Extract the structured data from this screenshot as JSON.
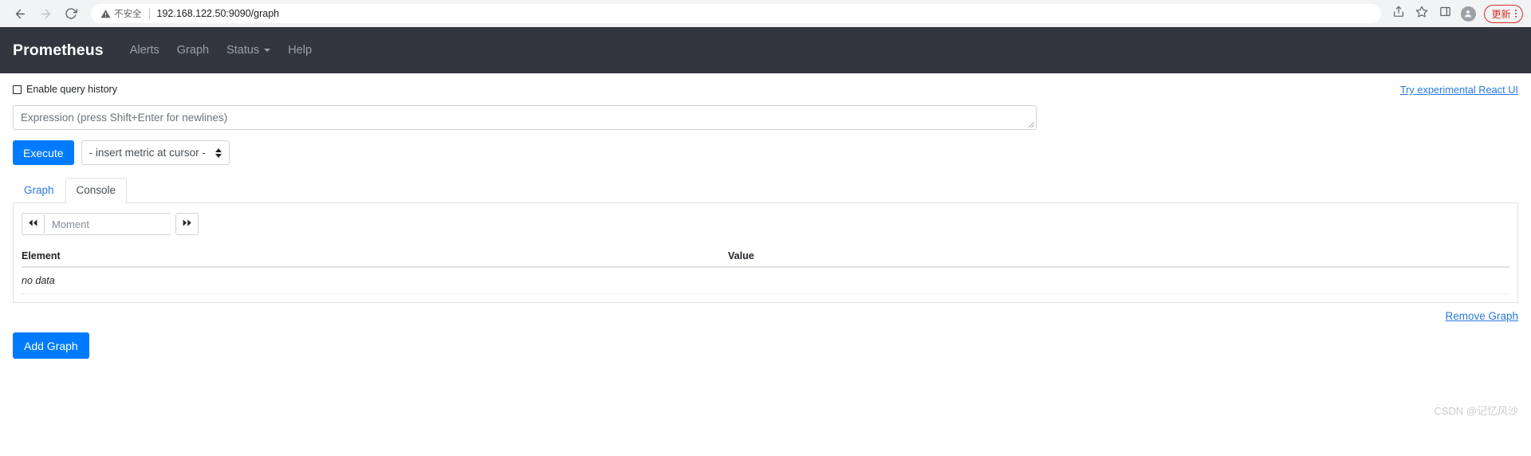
{
  "browser": {
    "back_icon": "arrow-left-icon",
    "forward_icon": "arrow-right-icon",
    "reload_icon": "reload-icon",
    "security_label": "不安全",
    "url": "192.168.122.50:9090/graph",
    "share_icon": "share-icon",
    "bookmark_icon": "star-icon",
    "sidepanel_icon": "side-panel-icon",
    "profile_icon": "profile-avatar-icon",
    "update_label": "更新",
    "menu_icon": "kebab-menu-icon"
  },
  "navbar": {
    "brand": "Prometheus",
    "links": [
      {
        "label": "Alerts",
        "has_caret": false
      },
      {
        "label": "Graph",
        "has_caret": false
      },
      {
        "label": "Status",
        "has_caret": true
      },
      {
        "label": "Help",
        "has_caret": false
      }
    ]
  },
  "query": {
    "history_label": "Enable query history",
    "history_checked": false,
    "react_ui_link": "Try experimental React UI",
    "expression_placeholder": "Expression (press Shift+Enter for newlines)",
    "expression_value": "",
    "execute_label": "Execute",
    "metric_select_value": "- insert metric at cursor -"
  },
  "tabs": [
    {
      "label": "Graph",
      "active": false
    },
    {
      "label": "Console",
      "active": true
    }
  ],
  "console": {
    "prev_icon": "double-chevron-left-icon",
    "next_icon": "double-chevron-right-icon",
    "moment_placeholder": "Moment",
    "moment_value": "",
    "columns": {
      "element": "Element",
      "value": "Value"
    },
    "rows": [],
    "empty_text": "no data"
  },
  "actions": {
    "remove_graph": "Remove Graph",
    "add_graph": "Add Graph"
  },
  "watermark": "CSDN @记忆风沙",
  "colors": {
    "primary": "#007bff",
    "link": "#2a7ae2",
    "navbar_bg": "#32373f",
    "update_red": "#d93025"
  }
}
